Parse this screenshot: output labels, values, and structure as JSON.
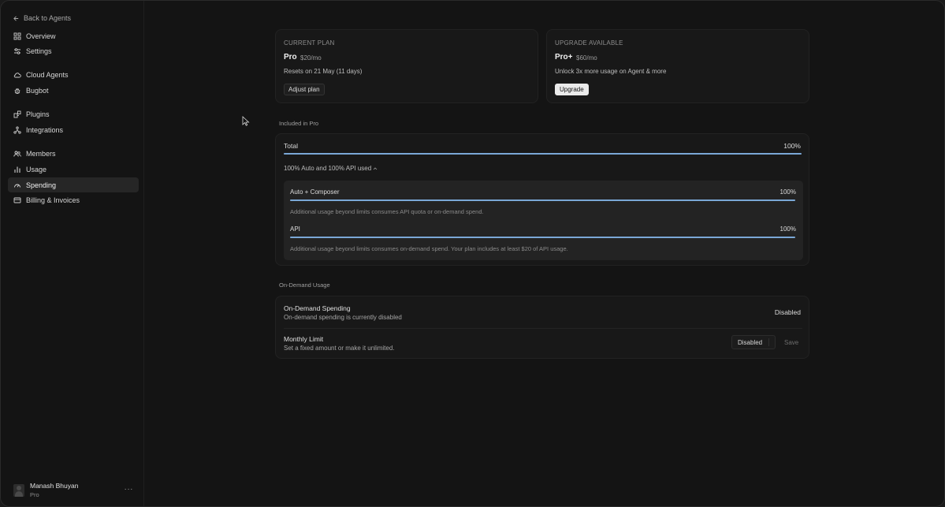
{
  "sidebar": {
    "back_label": "Back to Agents",
    "items": [
      {
        "label": "Overview",
        "icon": "grid-icon"
      },
      {
        "label": "Settings",
        "icon": "sliders-icon"
      },
      {
        "label": "Cloud Agents",
        "icon": "cloud-icon"
      },
      {
        "label": "Bugbot",
        "icon": "bug-icon"
      },
      {
        "label": "Plugins",
        "icon": "plugin-icon"
      },
      {
        "label": "Integrations",
        "icon": "integrations-icon"
      },
      {
        "label": "Members",
        "icon": "members-icon"
      },
      {
        "label": "Usage",
        "icon": "bar-chart-icon"
      },
      {
        "label": "Spending",
        "icon": "gauge-icon",
        "active": true
      },
      {
        "label": "Billing & Invoices",
        "icon": "card-icon"
      }
    ],
    "user": {
      "name": "Manash Bhuyan",
      "plan": "Pro",
      "more": "···"
    }
  },
  "current_plan": {
    "label": "CURRENT PLAN",
    "name": "Pro",
    "price": "$20/mo",
    "resets": "Resets on 21 May (11 days)",
    "button": "Adjust plan"
  },
  "upgrade": {
    "label": "UPGRADE AVAILABLE",
    "name": "Pro+",
    "price": "$60/mo",
    "description": "Unlock 3x more usage on Agent & more",
    "button": "Upgrade"
  },
  "included": {
    "title": "Included in Pro",
    "total_label": "Total",
    "total_value": "100%",
    "total_fraction": 1.0,
    "used_note": "100% Auto and 100% API used",
    "auto_label": "Auto + Composer",
    "auto_value": "100%",
    "auto_fraction": 1.0,
    "auto_note": "Additional usage beyond limits consumes API quota or on-demand spend.",
    "api_label": "API",
    "api_value": "100%",
    "api_fraction": 1.0,
    "api_note": "Additional usage beyond limits consumes on-demand spend. Your plan includes at least $20 of API usage."
  },
  "on_demand": {
    "title": "On-Demand Usage",
    "spending_title": "On-Demand Spending",
    "spending_sub": "On-demand spending is currently disabled",
    "spending_status": "Disabled",
    "limit_title": "Monthly Limit",
    "limit_sub": "Set a fixed amount or make it unlimited.",
    "limit_select": "Disabled",
    "save_label": "Save"
  },
  "colors": {
    "accent_bar": "#7aa7d6",
    "active_nav": "#262626"
  }
}
